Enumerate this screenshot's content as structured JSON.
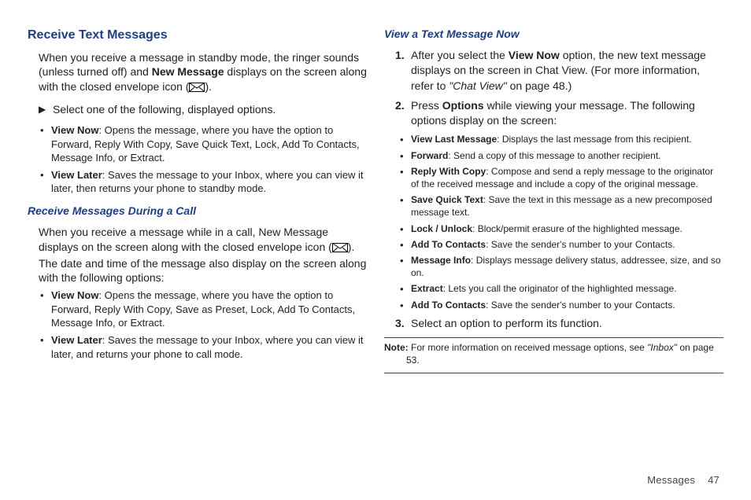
{
  "left": {
    "h1": "Receive Text Messages",
    "p1_a": "When you receive a message in standby mode, the ringer sounds (unless turned off) and ",
    "p1_bold": "New Message",
    "p1_b": " displays on the screen along with the closed envelope icon (",
    "p1_c": ").",
    "select_line": "Select one of the following, displayed options.",
    "b1_label": "View Now",
    "b1_text": ": Opens the message, where you have the option to Forward, Reply With Copy, Save Quick Text, Lock, Add To Contacts, Message Info, or Extract.",
    "b2_label": "View Later",
    "b2_text": ": Saves the message to your Inbox, where you can view it later, then returns your phone to standby mode.",
    "h2": "Receive Messages During a Call",
    "p2_a": "When you receive a message while in a call, New Message displays on the screen along with the closed envelope icon (",
    "p2_b": "). The date and time of the message also display on the screen along with the following options:",
    "b3_label": "View Now",
    "b3_text": ": Opens the message, where you have the option to Forward, Reply With Copy, Save as Preset, Lock, Add To Contacts, Message Info, or Extract.",
    "b4_label": "View Later",
    "b4_text": ": Saves the message to your Inbox, where you can view it later, and returns your phone to call mode."
  },
  "right": {
    "h1": "View a Text Message Now",
    "s1_a": "After you select the ",
    "s1_bold": "View Now",
    "s1_b": " option, the new text message displays on the screen in Chat View. (For more information, refer to ",
    "s1_ref_a": "\"Chat View\"",
    "s1_ref_b": " on page 48.)",
    "s2_a": "Press ",
    "s2_bold": "Options",
    "s2_b": " while viewing your message. The following options display on the screen:",
    "opts": [
      {
        "label": "View Last Message",
        "text": ": Displays the last message from this recipient."
      },
      {
        "label": "Forward",
        "text": ": Send a copy of this message to another recipient."
      },
      {
        "label": "Reply With Copy",
        "text": ": Compose and send a reply message to the originator of the received message and include a copy of the original message."
      },
      {
        "label": "Save Quick Text",
        "text": ": Save the text in this message as a new precomposed message text."
      },
      {
        "label": "Lock / Unlock",
        "text": ": Block/permit erasure of the highlighted message."
      },
      {
        "label": "Add To Contacts",
        "text": ": Save the sender's number to your Contacts."
      },
      {
        "label": "Message Info",
        "text": ": Displays message delivery status, addressee, size, and so on."
      },
      {
        "label": "Extract",
        "text": ": Lets you call the originator of the highlighted message."
      },
      {
        "label": "Add To Contacts",
        "text": ": Save the sender's number to your Contacts."
      }
    ],
    "s3": "Select an option to perform its function.",
    "note_label": "Note:",
    "note_a": " For more information on received message options, see ",
    "note_ref": "\"Inbox\"",
    "note_b": " on page 53."
  },
  "footer": {
    "label": "Messages",
    "page": "47"
  },
  "icons": {
    "pointer": "▶"
  }
}
